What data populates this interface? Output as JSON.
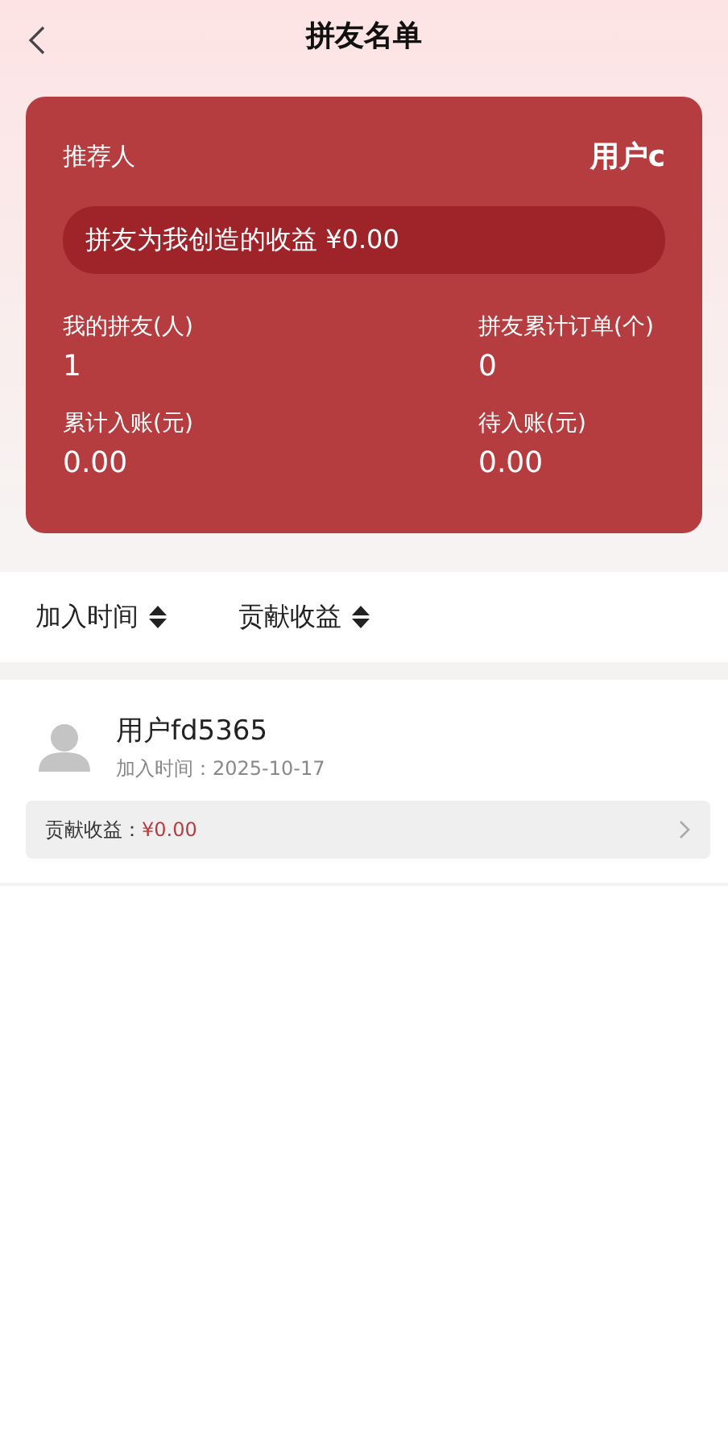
{
  "header": {
    "title": "拼友名单"
  },
  "summary": {
    "referrer_label": "推荐人",
    "referrer_name": "用户c",
    "earnings_banner": "拼友为我创造的收益 ¥0.00",
    "stats": [
      {
        "label": "我的拼友(人)",
        "value": "1"
      },
      {
        "label": "拼友累计订单(个)",
        "value": "0"
      },
      {
        "label": "累计入账(元)",
        "value": "0.00"
      },
      {
        "label": "待入账(元)",
        "value": "0.00"
      }
    ]
  },
  "sort_options": [
    {
      "label": "加入时间"
    },
    {
      "label": "贡献收益"
    }
  ],
  "members": [
    {
      "name": "用户fd5365",
      "joined": "加入时间：2025-10-17",
      "contribution_label": "贡献收益：",
      "contribution_value": "¥0.00"
    }
  ]
}
